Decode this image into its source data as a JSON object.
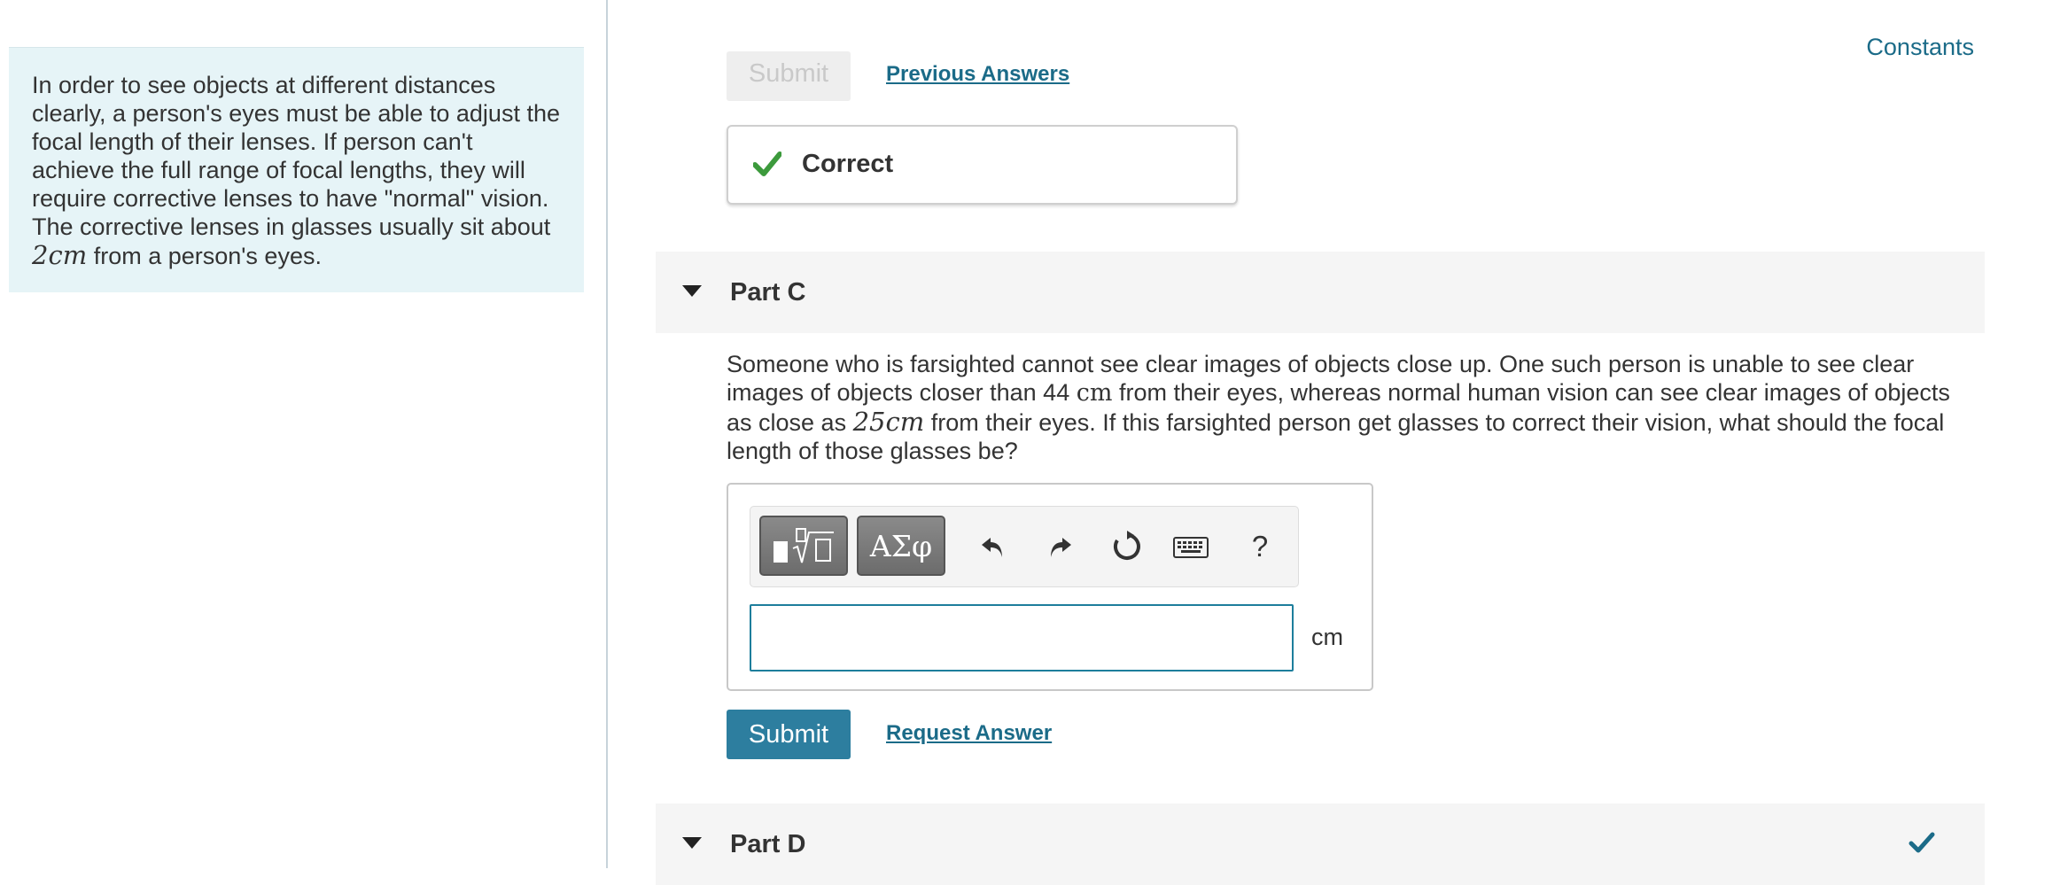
{
  "intro": {
    "text_before": "In order to see objects at different distances clearly, a person's eyes must be able to adjust the focal length of their lenses.  If person can't achieve the full range of focal lengths, they will require corrective lenses to have \"normal\" vision.  The corrective lenses in glasses usually sit about ",
    "distance": "2cm",
    "text_after": " from a person's eyes."
  },
  "header": {
    "constants_link": "Constants"
  },
  "part_b": {
    "submit_label": "Submit",
    "previous_answers_link": "Previous Answers",
    "feedback": "Correct"
  },
  "part_c": {
    "title": "Part C",
    "question_1": "Someone who is farsighted cannot see clear images of objects close up.  One such person is unable to see clear images of objects closer than 44 ",
    "unit_math": "cm",
    "question_2": " from their eyes, whereas normal human vision can see clear images of objects as close as ",
    "normal_distance": "25cm",
    "question_3": " from their eyes.  If this farsighted person get glasses to correct their vision, what should the focal length of those glasses be?",
    "toolbar": {
      "templates_icon": "templates-sqrt-icon",
      "symbols_label": "ΑΣφ",
      "help_label": "?"
    },
    "answer_value": "",
    "answer_unit": "cm",
    "submit_label": "Submit",
    "request_answer_link": "Request Answer"
  },
  "part_d": {
    "title": "Part D"
  },
  "colors": {
    "accent": "#2d7e9f",
    "link": "#1b6b88",
    "correct_green": "#3c9a3c",
    "intro_bg": "#e6f4f7",
    "part_header_bg": "#f5f5f5"
  }
}
